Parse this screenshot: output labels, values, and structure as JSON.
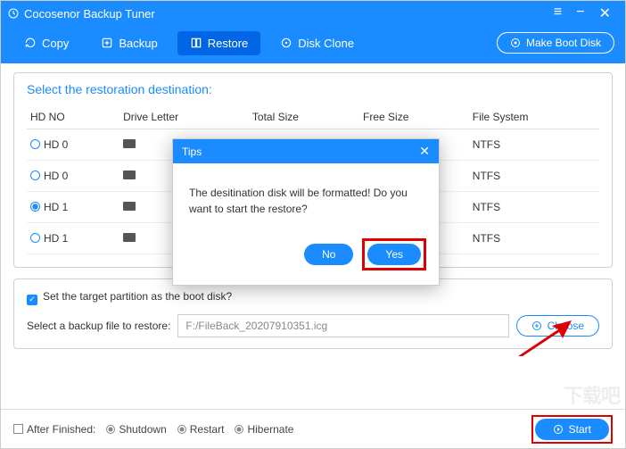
{
  "app": {
    "title": "Cocosenor Backup Tuner"
  },
  "toolbar": {
    "copy": "Copy",
    "backup": "Backup",
    "restore": "Restore",
    "disk_clone": "Disk Clone",
    "make_boot": "Make Boot Disk"
  },
  "panel": {
    "title": "Select the restoration destination:",
    "headers": {
      "hdno": "HD NO",
      "drive": "Drive Letter",
      "total": "Total Size",
      "free": "Free Size",
      "fs": "File System"
    },
    "rows": [
      {
        "hd": "HD 0",
        "fs": "NTFS",
        "selected": false
      },
      {
        "hd": "HD 0",
        "fs": "NTFS",
        "selected": false
      },
      {
        "hd": "HD 1",
        "fs": "NTFS",
        "selected": true
      },
      {
        "hd": "HD 1",
        "fs": "NTFS",
        "selected": false
      }
    ]
  },
  "lower": {
    "boot_check": "Set the target partition as the boot disk?",
    "select_label": "Select a backup file to restore:",
    "path": "F:/FileBack_20207910351.icg",
    "choose": "Choose"
  },
  "footer": {
    "after": "After Finished:",
    "shutdown": "Shutdown",
    "restart": "Restart",
    "hibernate": "Hibernate",
    "start": "Start"
  },
  "modal": {
    "title": "Tips",
    "body": "The desitination disk will be formatted! Do you want to start the restore?",
    "no": "No",
    "yes": "Yes"
  }
}
